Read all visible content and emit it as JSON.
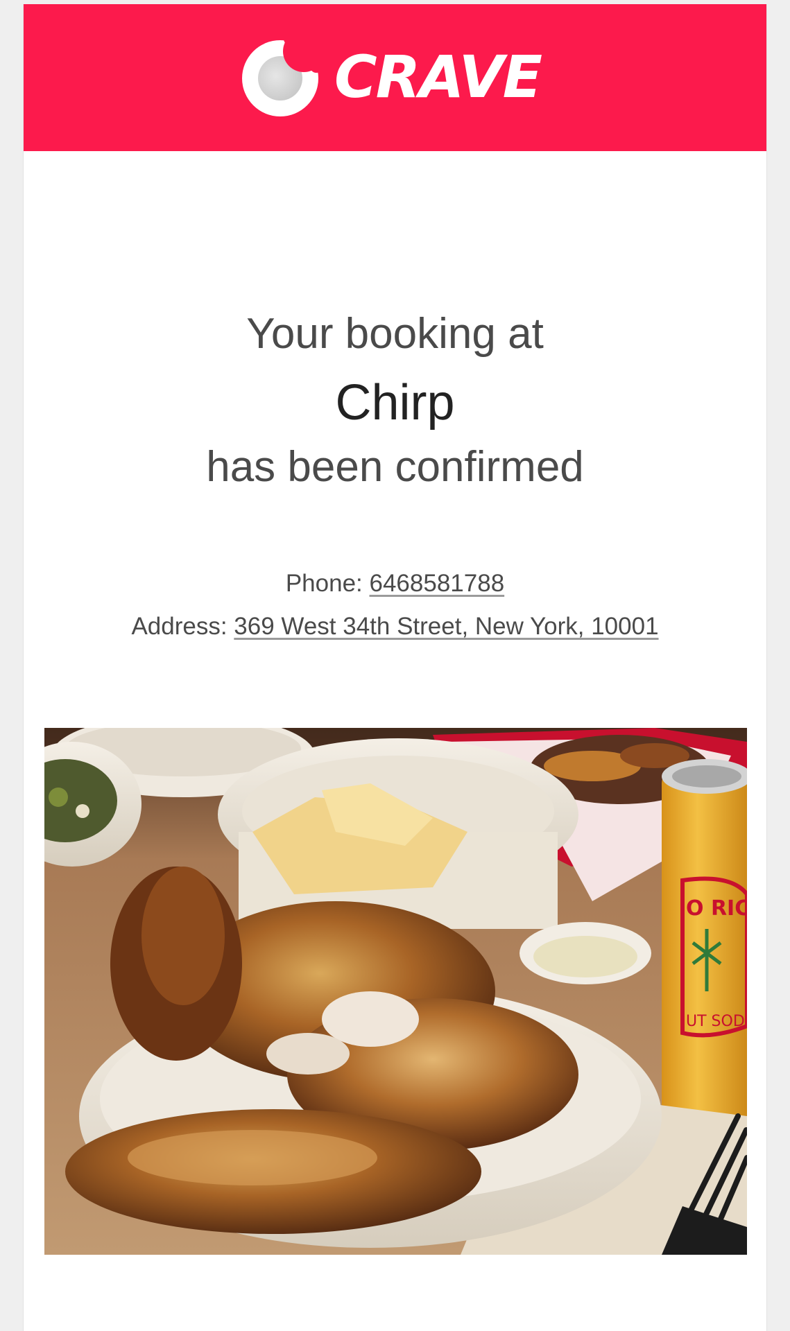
{
  "brand": {
    "name": "CRAVE",
    "color": "#fc1a4c",
    "icon": "bitten-moon-logo-icon"
  },
  "confirmation": {
    "line1": "Your booking at",
    "restaurant": "Chirp",
    "line3": "has been confirmed"
  },
  "contact": {
    "phone_label": "Phone:",
    "phone_value": "6468581788",
    "address_label": "Address:",
    "address_value": "369 West 34th Street, New York, 10001"
  },
  "hero_image": {
    "icon": "food-photo",
    "can_text_1": "O RICO",
    "can_text_2": "UT SODA"
  }
}
